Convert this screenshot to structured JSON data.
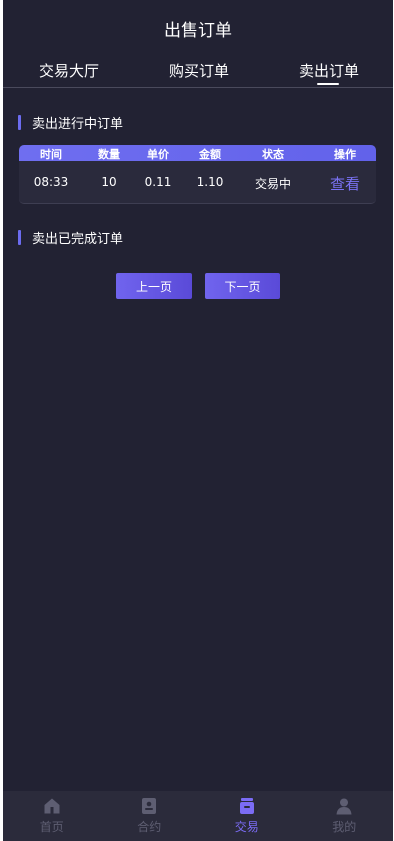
{
  "header": {
    "title": "出售订单"
  },
  "tabs": [
    {
      "label": "交易大厅",
      "active": false
    },
    {
      "label": "购买订单",
      "active": false
    },
    {
      "label": "卖出订单",
      "active": true
    }
  ],
  "sections": {
    "in_progress_title": "卖出进行中订单",
    "completed_title": "卖出已完成订单"
  },
  "table": {
    "headers": [
      "时间",
      "数量",
      "单价",
      "金额",
      "状态",
      "操作"
    ],
    "rows": [
      {
        "time": "08:33",
        "quantity": "10",
        "unit_price": "0.11",
        "amount": "1.10",
        "status": "交易中",
        "action": "查看"
      }
    ]
  },
  "pagination": {
    "prev_label": "上一页",
    "next_label": "下一页"
  },
  "bottom_nav": [
    {
      "label": "首页",
      "icon": "home-icon",
      "active": false
    },
    {
      "label": "合约",
      "icon": "contract-icon",
      "active": false
    },
    {
      "label": "交易",
      "icon": "trade-icon",
      "active": true
    },
    {
      "label": "我的",
      "icon": "user-icon",
      "active": false
    }
  ],
  "colors": {
    "background": "#222233",
    "accent": "#6c6cf0",
    "link": "#7a72f2",
    "nav_inactive": "#5e5e72",
    "nav_active": "#7b6cf5"
  }
}
